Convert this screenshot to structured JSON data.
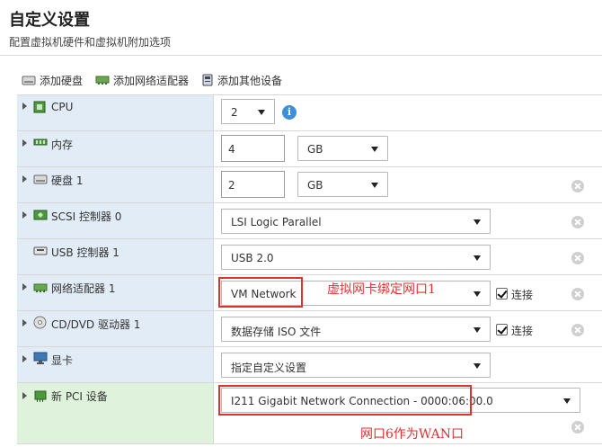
{
  "header": {
    "title": "自定义设置",
    "subtitle": "配置虚拟机硬件和虚拟机附加选项"
  },
  "toolbar": {
    "add_disk": "添加硬盘",
    "add_nic": "添加网络适配器",
    "add_other": "添加其他设备"
  },
  "rows": {
    "cpu": {
      "label": "CPU",
      "value": "2"
    },
    "memory": {
      "label": "内存",
      "value": "4",
      "unit": "GB"
    },
    "disk": {
      "label": "硬盘 1",
      "value": "2",
      "unit": "GB"
    },
    "scsi": {
      "label": "SCSI 控制器 0",
      "value": "LSI Logic Parallel"
    },
    "usb": {
      "label": "USB 控制器 1",
      "value": "USB 2.0"
    },
    "nic": {
      "label": "网络适配器 1",
      "value": "VM Network",
      "connect_label": "连接",
      "annotation": "虚拟网卡绑定网口1"
    },
    "cdrom": {
      "label": "CD/DVD 驱动器 1",
      "value": "数据存储 ISO 文件",
      "connect_label": "连接"
    },
    "display": {
      "label": "显卡",
      "value": "指定自定义设置"
    },
    "pci": {
      "label": "新 PCI 设备",
      "value": "I211 Gigabit Network Connection - 0000:06:00.0",
      "annotation": "网口6作为WAN口"
    }
  },
  "colors": {
    "label_bg_blue": "#e1ecf7",
    "label_bg_green": "#dff2dc",
    "annotation_red": "#e03131",
    "info_blue": "#3d8fd7"
  },
  "icons": [
    "disk-icon",
    "network-card-icon",
    "device-icon",
    "chip-icon",
    "memory-icon",
    "scsi-icon",
    "usb-icon",
    "cdrom-icon",
    "monitor-icon",
    "pci-icon",
    "info-icon",
    "remove-icon"
  ]
}
